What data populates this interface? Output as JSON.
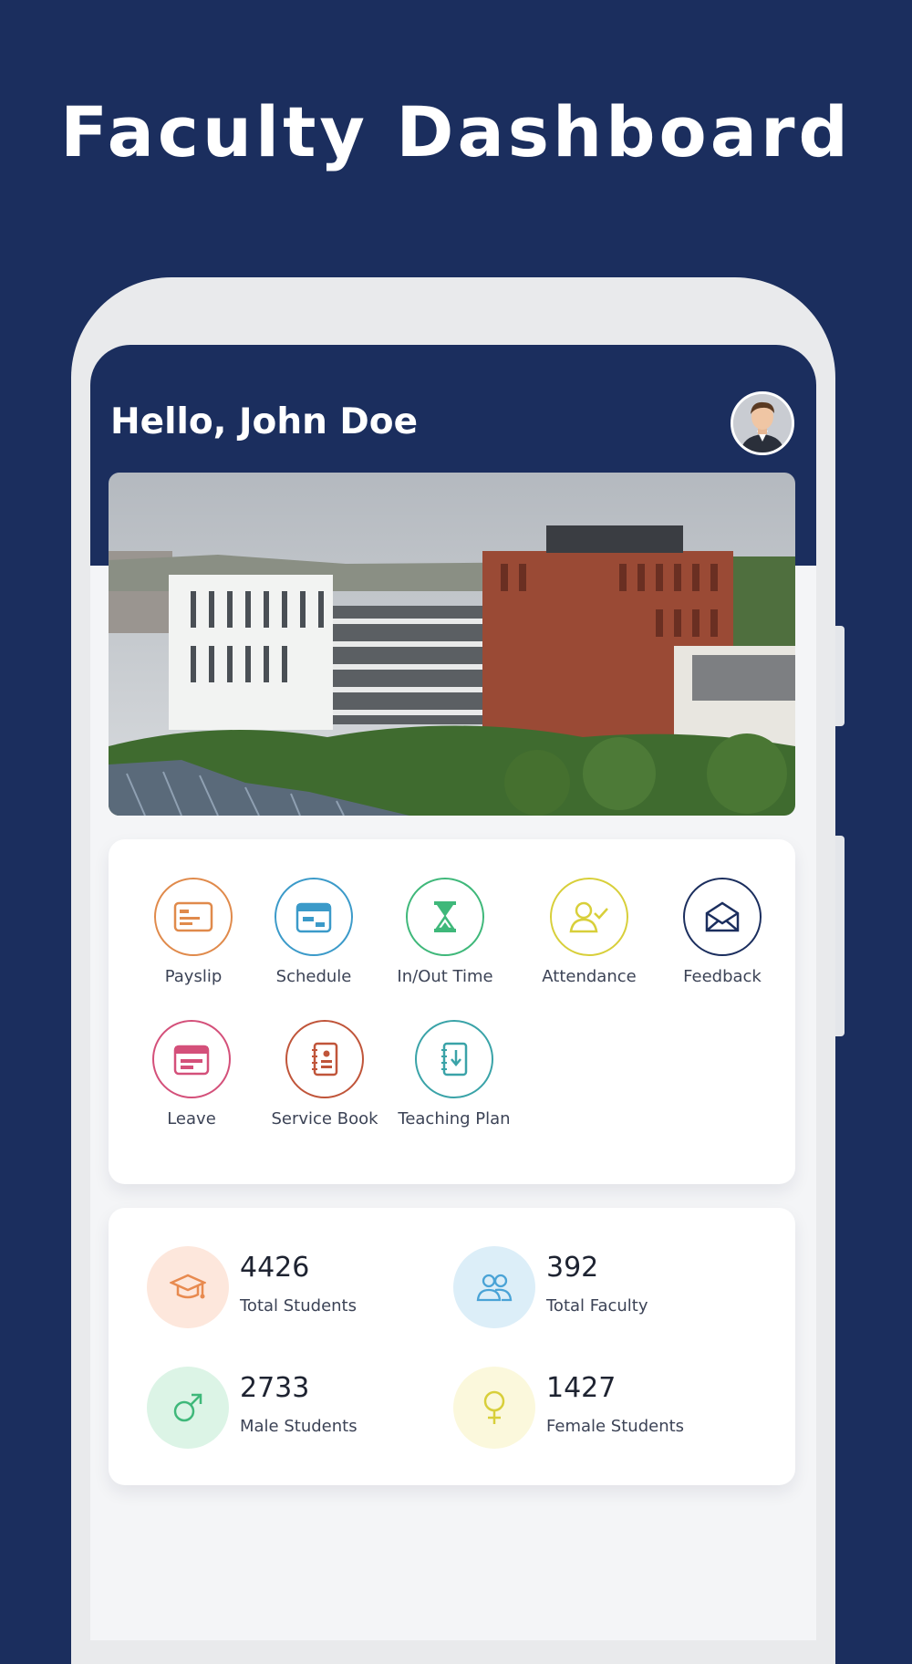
{
  "promo": {
    "title": "Faculty Dashboard"
  },
  "header": {
    "greeting": "Hello, John Doe"
  },
  "menu": {
    "items": [
      {
        "label": "Payslip",
        "icon": "payslip-card-icon",
        "color": "#e08a4b"
      },
      {
        "label": "Schedule",
        "icon": "calendar-icon",
        "color": "#3b9ac9"
      },
      {
        "label": "In/Out Time",
        "icon": "hourglass-icon",
        "color": "#3fb87a"
      },
      {
        "label": "Attendance",
        "icon": "user-check-icon",
        "color": "#d8cf3a"
      },
      {
        "label": "Feedback",
        "icon": "envelope-icon",
        "color": "#1b2e5e"
      },
      {
        "label": "Leave",
        "icon": "calendar-leave-icon",
        "color": "#d4507a"
      },
      {
        "label": "Service Book",
        "icon": "book-icon",
        "color": "#c0553a"
      },
      {
        "label": "Teaching Plan",
        "icon": "notebook-download-icon",
        "color": "#3aa3a8"
      }
    ]
  },
  "stats": {
    "items": [
      {
        "value": "4426",
        "label": "Total Students",
        "icon": "graduation-cap-icon",
        "color": "#e88a4f",
        "bg": "#fde7dc"
      },
      {
        "value": "392",
        "label": "Total Faculty",
        "icon": "users-icon",
        "color": "#4aa3d6",
        "bg": "#dceef8"
      },
      {
        "value": "2733",
        "label": "Male Students",
        "icon": "male-symbol-icon",
        "color": "#3fb87a",
        "bg": "#dcf4e6"
      },
      {
        "value": "1427",
        "label": "Female Students",
        "icon": "female-symbol-icon",
        "color": "#d8cf3a",
        "bg": "#fbf8dc"
      }
    ]
  },
  "colors": {
    "brand": "#1b2e5e",
    "screen_bg": "#f4f5f7",
    "card": "#ffffff"
  }
}
